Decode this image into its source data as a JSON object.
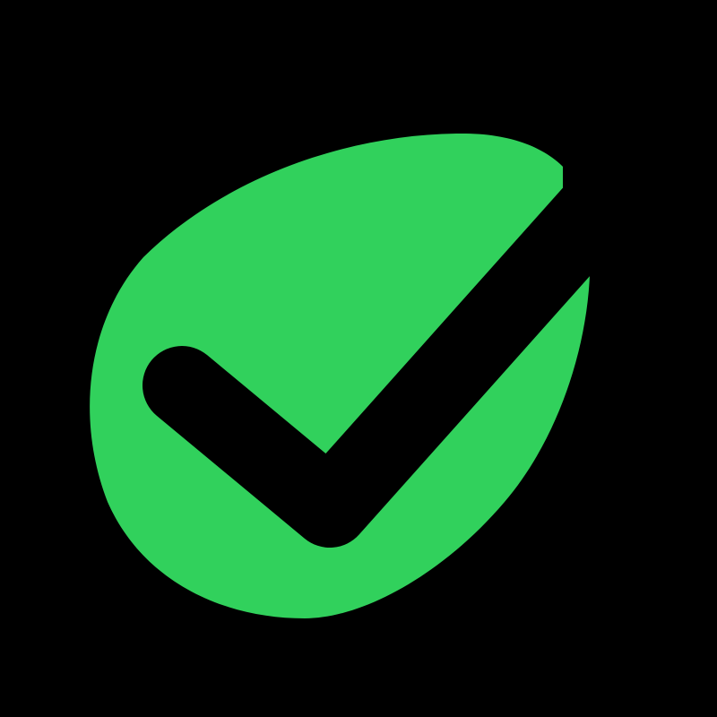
{
  "logo": {
    "icon": "leaf-check-icon",
    "colors": {
      "background": "#000000",
      "leaf": "#31D15C",
      "check": "#000000"
    }
  }
}
